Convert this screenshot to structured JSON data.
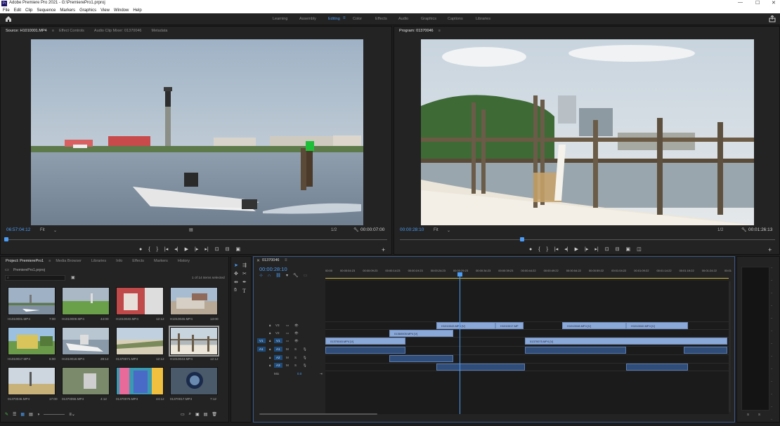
{
  "titlebar": {
    "title": "Adobe Premiere Pro 2021 - G:\\PremierePro1.prproj"
  },
  "menu": [
    "File",
    "Edit",
    "Clip",
    "Sequence",
    "Markers",
    "Graphics",
    "View",
    "Window",
    "Help"
  ],
  "workspaces": [
    "Learning",
    "Assembly",
    "Editing",
    "Color",
    "Effects",
    "Audio",
    "Graphics",
    "Captions",
    "Libraries"
  ],
  "source": {
    "tabs": [
      "Source: H1010001.MP4",
      "Effect Controls",
      "Audio Clip Mixer: 01370046",
      "Metadata"
    ],
    "timecode": "06:57:04:12",
    "fit": "Fit",
    "ratio": "1/2",
    "duration": "00:00:07:00"
  },
  "program": {
    "tab": "Program: 01370046",
    "timecode": "00:00:28:10",
    "fit": "Fit",
    "ratio": "1/2",
    "duration": "00:01:26:13"
  },
  "project": {
    "tabs": [
      "Project: PremierePro1",
      "Media Browser",
      "Libraries",
      "Info",
      "Effects",
      "Markers",
      "History"
    ],
    "filename": "PremierePro1.prproj",
    "count": "1 of 14 items selected",
    "items": [
      {
        "name": "H1010001.MP4",
        "dur": "7:00"
      },
      {
        "name": "H1010009.MP4",
        "dur": "44:00"
      },
      {
        "name": "H1010040.MP4",
        "dur": "12:12"
      },
      {
        "name": "H1010045.MP4",
        "dur": "13:00"
      },
      {
        "name": "H1010017.MP4",
        "dur": "6:00"
      },
      {
        "name": "H1010018.MP4",
        "dur": "28:12"
      },
      {
        "name": "01370071.MP4",
        "dur": "12:12"
      },
      {
        "name": "H1010043.MP4",
        "dur": "12:12"
      },
      {
        "name": "01370045.MP4",
        "dur": "17:00"
      },
      {
        "name": "01370055.MP4",
        "dur": "4:12"
      },
      {
        "name": "01370075.MP4",
        "dur": "44:12"
      },
      {
        "name": "01370017.MP4",
        "dur": "7:12"
      }
    ]
  },
  "timeline": {
    "tab": "01370046",
    "timecode": "00:00:28:10",
    "ruler": [
      "00:00",
      "00:00:04:23",
      "00:00:09:23",
      "00:00:14:23",
      "00:00:19:23",
      "00:00:24:23",
      "00:00:29:23",
      "00:00:34:23",
      "00:00:39:23",
      "00:00:44:22",
      "00:00:49:22",
      "00:00:54:22",
      "00:00:59:22",
      "00:01:04:22",
      "00:01:09:22",
      "00:01:14:22",
      "00:01:19:22",
      "00:01:24:22",
      "00:01"
    ],
    "tracks": [
      "V3",
      "V2",
      "V1",
      "A1",
      "A2",
      "A3"
    ],
    "v1src": "V1",
    "a1src": "A1",
    "mix": "Mix",
    "mixval": "0.0",
    "clips": {
      "c1": "H1010043.MP4 [V]",
      "c2": "H1010017.MP",
      "c3": "H1010048.MP4 [V]",
      "c4": "H1010040.MP4 [V]",
      "c5": "01360005.MP4 [V]",
      "c6": "01370045.MP4 [V]",
      "c7": "01370075.MP4 [V]"
    }
  },
  "meter": {
    "labels": [
      "S",
      "S"
    ]
  }
}
